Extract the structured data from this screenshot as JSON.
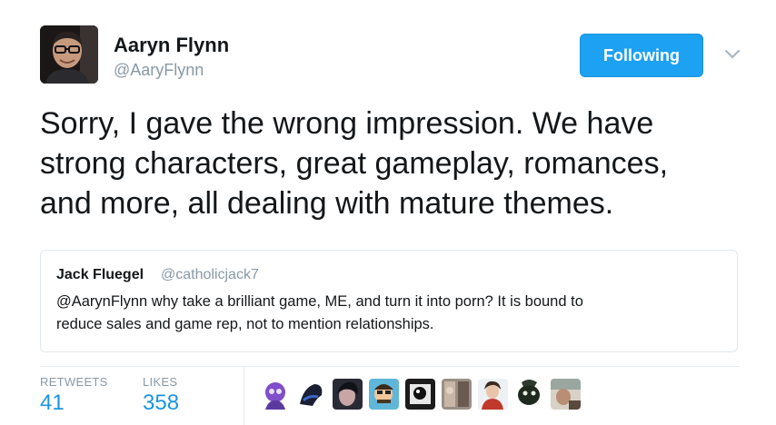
{
  "author": {
    "name": "Aaryn Flynn",
    "handle": "@AaryFlynn"
  },
  "follow_button": {
    "label": "Following"
  },
  "tweet": {
    "lines": [
      "Sorry, I gave the wrong impression. We have",
      "strong characters, great gameplay, romances,",
      "and more, all dealing with mature themes."
    ]
  },
  "quoted_tweet": {
    "name": "Jack Fluegel",
    "handle": "@catholicjack7",
    "lines": [
      "@AarynFlynn why take a brilliant game, ME, and turn it into porn? It is bound to",
      "reduce sales and game rep, not to mention relationships."
    ]
  },
  "stats": {
    "retweets_label": "RETWEETS",
    "retweets_value": "41",
    "likes_label": "LIKES",
    "likes_value": "358"
  },
  "icons": {
    "menu": "chevron-down-icon"
  },
  "colors": {
    "accent": "#1da1f2",
    "stat_value": "#1b95e0",
    "muted": "#8899a6",
    "text": "#14171a"
  }
}
